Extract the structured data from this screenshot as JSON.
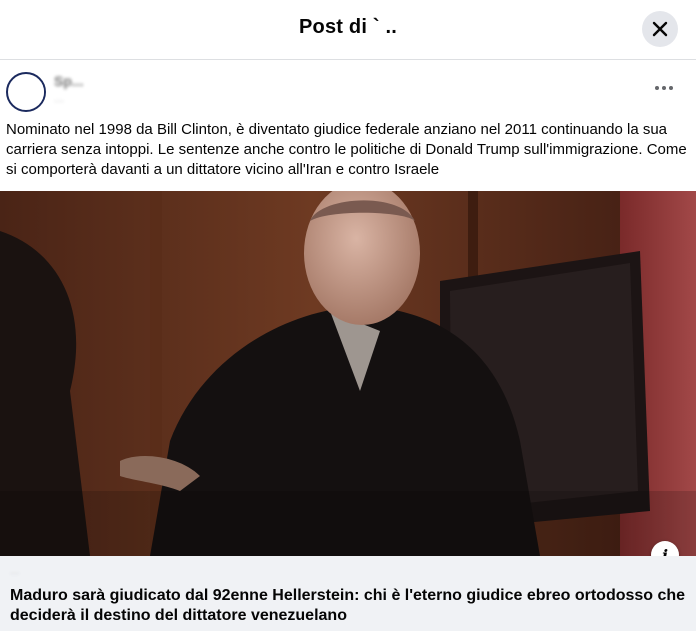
{
  "dialog": {
    "title": "Post di  ` ..",
    "close_icon": "close-icon"
  },
  "post": {
    "author_name": "Sp...",
    "time": "...",
    "more_icon": "more-options-icon",
    "text": "Nominato nel 1998 da Bill Clinton, è diventato giudice federale anziano nel 2011 continuando la sua carriera senza intoppi. Le sentenze anche contro le politiche di Donald Trump sull'immigrazione. Come si comporterà davanti a un dittatore vicino all'Iran e contro Israele"
  },
  "link_preview": {
    "domain": "...",
    "title": "Maduro sarà giudicato dal 92enne Hellerstein: chi è l'eterno giudice ebreo ortodosso che deciderà il destino del dittatore venezuelano",
    "info_icon": "info-icon"
  },
  "colors": {
    "header_border": "#dddfe2",
    "close_bg": "#e4e6eb",
    "preview_bg": "#f0f2f5",
    "secondary_text": "#65676b"
  }
}
